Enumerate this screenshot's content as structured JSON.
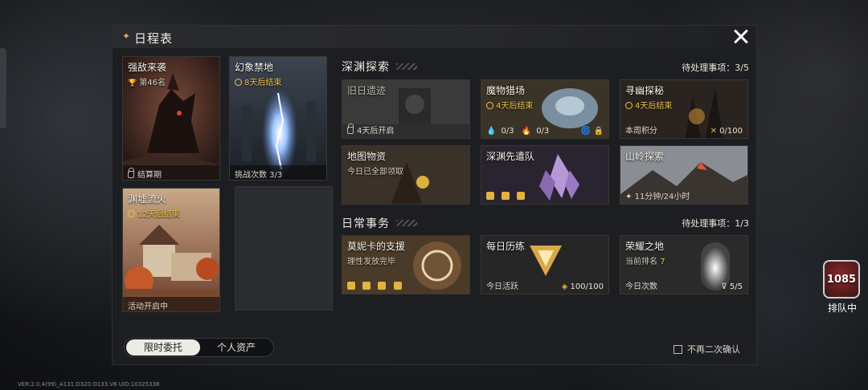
{
  "panel": {
    "title": "日程表"
  },
  "side_cards": [
    {
      "title": "强敌来袭",
      "sub": "第46名",
      "foot": "结算期"
    },
    {
      "title": "幻象禁地",
      "sub": "8天后结束",
      "foot": "挑战次数 3/3"
    },
    {
      "title": "渊墟流火",
      "sub": "12天后结束",
      "foot": "活动开启中"
    }
  ],
  "tabs": {
    "active": "限时委托",
    "inactive": "个人资产"
  },
  "abyss": {
    "title": "深渊探索",
    "pending": "待处理事项：3/5",
    "cards": [
      {
        "title": "旧日遗迹",
        "foot": "4天后开启"
      },
      {
        "title": "魔物猎场",
        "sub": "4天后结束",
        "stat1": "0/3",
        "stat2": "0/3"
      },
      {
        "title": "寻幽探秘",
        "sub": "4天后结束",
        "foot_left": "本周积分",
        "foot_right": "0/100"
      },
      {
        "title": "地图物资",
        "sub": "今日已全部领取"
      },
      {
        "title": "深渊先遣队"
      },
      {
        "title": "山岭探索",
        "foot": "11分钟/24小时"
      }
    ]
  },
  "daily": {
    "title": "日常事务",
    "pending": "待处理事项：1/3",
    "cards": [
      {
        "title": "莫妮卡的支援",
        "sub": "理性发放完毕"
      },
      {
        "title": "每日历练",
        "foot_left": "今日活跃",
        "foot_right": "100/100"
      },
      {
        "title": "荣耀之地",
        "sub_label": "当前排名",
        "sub_value": "7",
        "foot_left": "今日次数",
        "foot_right": "5/5"
      }
    ]
  },
  "confirm": {
    "label": "不再二次确认"
  },
  "version": "VER:2.0.4(99)_A131.D320.O133.V6   UID:10325338",
  "queue": {
    "number": "1085",
    "label": "排队中"
  },
  "colors": {
    "accent_gold": "#f0c24a",
    "panel_bg": "#1d1e21"
  }
}
